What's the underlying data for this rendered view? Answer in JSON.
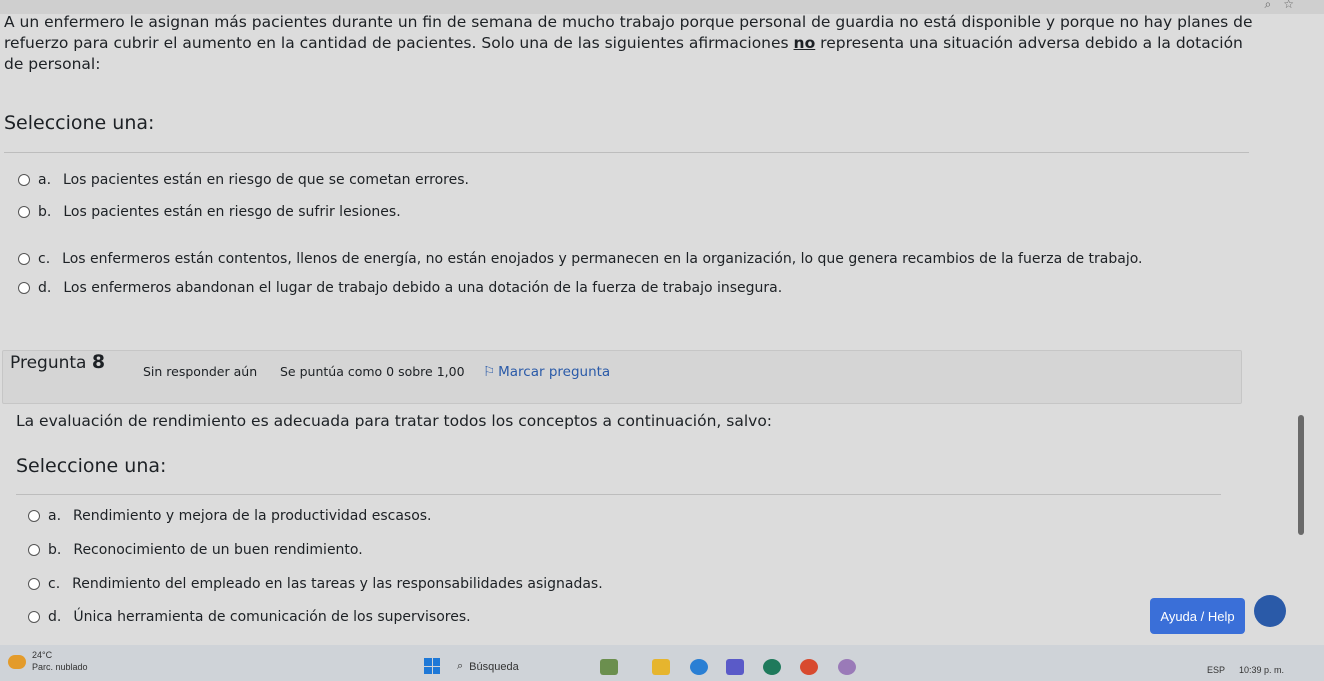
{
  "question7": {
    "text_before": "A un enfermero le asignan más pacientes durante un fin de semana de mucho trabajo porque personal de guardia no está disponible y porque no hay planes de refuerzo para cubrir el aumento en la cantidad de pacientes. Solo una de las siguientes afirmaciones ",
    "text_emph": "no",
    "text_after": " representa una situación adversa debido a la dotación de personal:",
    "select_label": "Seleccione una:",
    "answers": [
      {
        "letter": "a.",
        "text": "Los pacientes están en riesgo de que se cometan errores."
      },
      {
        "letter": "b.",
        "text": "Los pacientes están en riesgo de sufrir lesiones."
      },
      {
        "letter": "c.",
        "text": "Los enfermeros están contentos, llenos de energía, no están enojados y permanecen en la organización, lo que genera recambios de la fuerza de trabajo."
      },
      {
        "letter": "d.",
        "text": "Los enfermeros abandonan el lugar de trabajo debido a una dotación de la fuerza de trabajo insegura."
      }
    ]
  },
  "question8": {
    "label": "Pregunta",
    "number": "8",
    "status": "Sin responder aún",
    "points": "Se puntúa como 0 sobre 1,00",
    "flag_label": "Marcar pregunta",
    "text": "La evaluación de rendimiento es adecuada para tratar todos los conceptos a continuación, salvo:",
    "select_label": "Seleccione una:",
    "answers": [
      {
        "letter": "a.",
        "text": "Rendimiento y mejora de la productividad escasos."
      },
      {
        "letter": "b.",
        "text": "Reconocimiento de un buen rendimiento."
      },
      {
        "letter": "c.",
        "text": "Rendimiento del empleado en las tareas y las responsabilidades asignadas."
      },
      {
        "letter": "d.",
        "text": "Única herramienta de comunicación de los supervisores."
      }
    ]
  },
  "help_button": "Ayuda / Help",
  "taskbar": {
    "temperature": "24°C",
    "weather": "Parc. nublado",
    "search_placeholder": "Búsqueda",
    "language": "ESP",
    "time": "10:39 p. m."
  }
}
